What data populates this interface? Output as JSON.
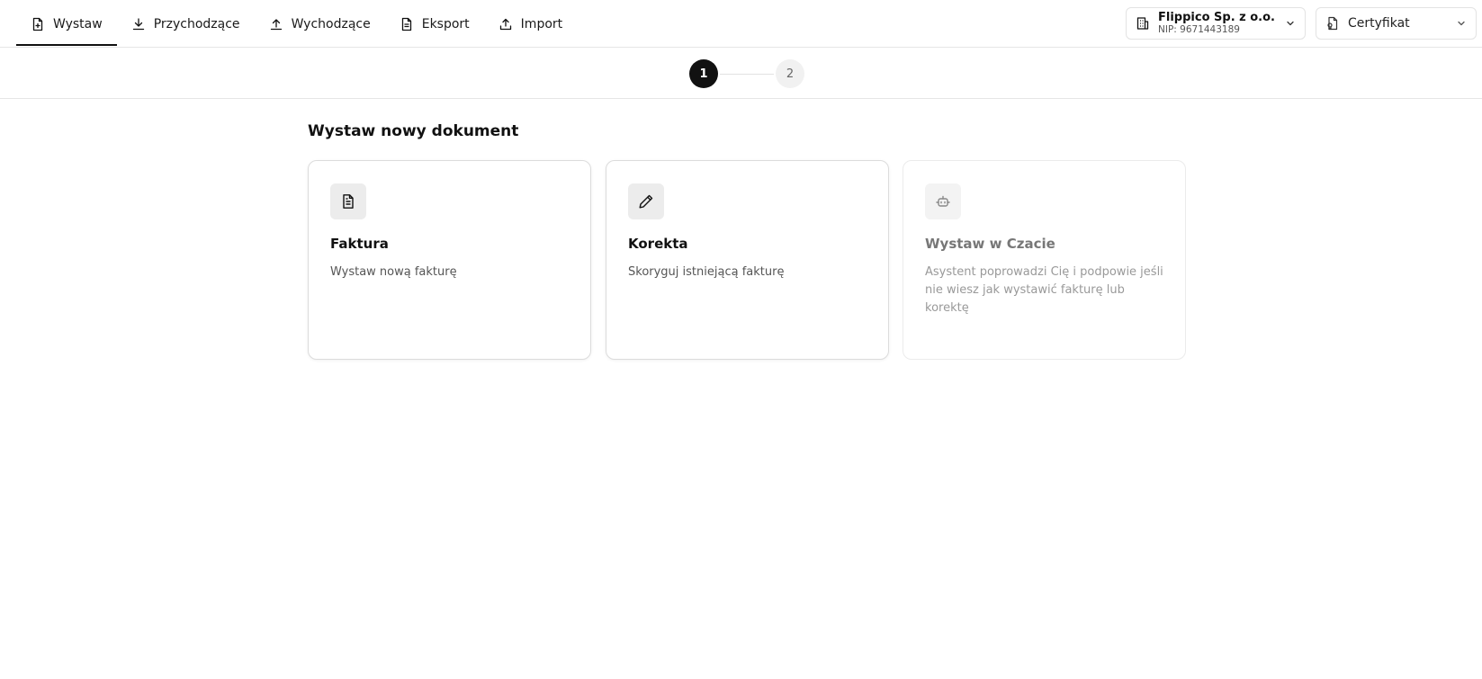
{
  "nav": {
    "tabs": [
      {
        "label": "Wystaw",
        "icon": "file-plus-icon",
        "active": true
      },
      {
        "label": "Przychodzące",
        "icon": "download-icon",
        "active": false
      },
      {
        "label": "Wychodzące",
        "icon": "upload-icon",
        "active": false
      },
      {
        "label": "Eksport",
        "icon": "file-text-icon",
        "active": false
      },
      {
        "label": "Import",
        "icon": "import-icon",
        "active": false
      }
    ]
  },
  "company_selector": {
    "name": "Flippico Sp. z o.o.",
    "nip": "NIP: 9671443189",
    "icon": "building-icon"
  },
  "certificate_selector": {
    "label": "Certyfikat",
    "icon": "certificate-icon"
  },
  "stepper": {
    "steps": [
      "1",
      "2"
    ],
    "current": "1"
  },
  "main": {
    "heading": "Wystaw nowy dokument",
    "cards": [
      {
        "title": "Faktura",
        "description": "Wystaw nową fakturę",
        "icon": "document-icon",
        "enabled": true
      },
      {
        "title": "Korekta",
        "description": "Skoryguj istniejącą fakturę",
        "icon": "pencil-icon",
        "enabled": true
      },
      {
        "title": "Wystaw w Czacie",
        "description": "Asystent poprowadzi Cię i podpowie jeśli nie wiesz jak wystawić fakturę lub korektę",
        "icon": "bot-icon",
        "enabled": false
      }
    ]
  },
  "colors": {
    "accent": "#111111",
    "border": "#e3e3e3",
    "muted_text": "#555555",
    "icon_box": "#ececec"
  }
}
